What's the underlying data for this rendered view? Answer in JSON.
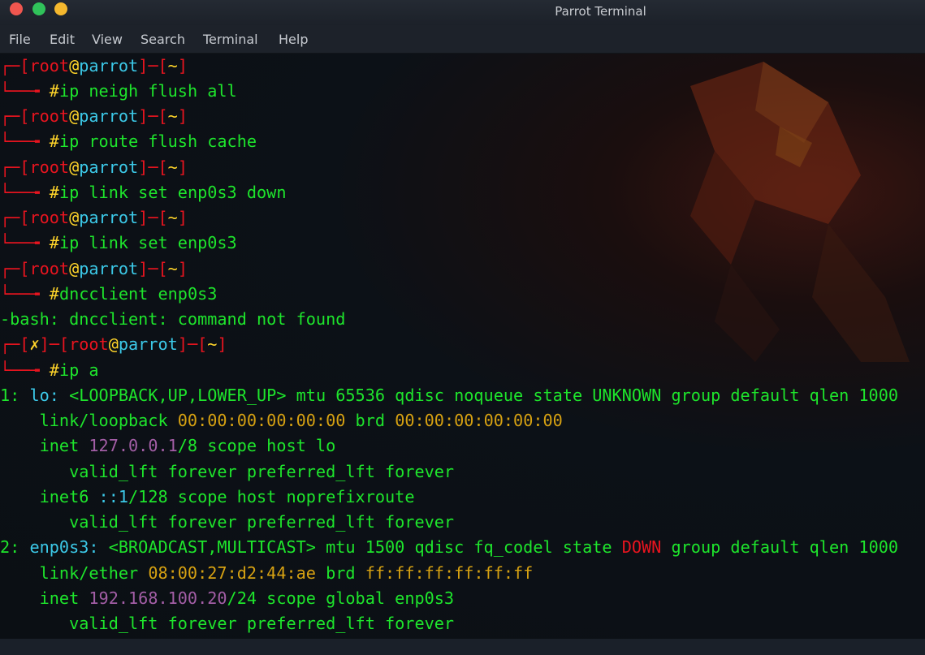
{
  "window": {
    "title": "Parrot Terminal"
  },
  "menu": [
    "File",
    "Edit",
    "View",
    "Search",
    "Terminal",
    "Help"
  ],
  "prompt": {
    "open": "┌─[",
    "user": "root",
    "at": "@",
    "host": "parrot",
    "mid": "]─[",
    "dir": "~",
    "close": "]",
    "arrow": "└──╼ ",
    "hash": "#",
    "err_open": "┌─[",
    "err_mark": "✗",
    "err_mid": "]─["
  },
  "commands": [
    "ip neigh flush all",
    "ip route flush cache",
    "ip link set enp0s3 down",
    "ip link set enp0s3",
    "dncclient enp0s3",
    "ip a"
  ],
  "error": "-bash: dncclient: command not found",
  "output": {
    "lo_head_a": "1: ",
    "lo_name": "lo:",
    "lo_head_b": " <LOOPBACK,UP,LOWER_UP> mtu 65536 qdisc noqueue state UNKNOWN group default qlen 1000",
    "lo_link_a": "    link/loopback ",
    "lo_mac": "00:00:00:00:00:00",
    "lo_link_b": " brd ",
    "lo_brd": "00:00:00:00:00:00",
    "lo_inet_a": "    inet ",
    "lo_ip": "127.0.0.1",
    "lo_inet_b": "/8 scope host lo",
    "valid1": "       valid_lft forever preferred_lft forever",
    "lo_inet6_a": "    inet6 ",
    "lo_ip6": "::1",
    "lo_inet6_b": "/128 scope host noprefixroute",
    "valid2": "       valid_lft forever preferred_lft forever",
    "en_head_a": "2: ",
    "en_name": "enp0s3:",
    "en_head_b": " <BROADCAST,MULTICAST> mtu 1500 qdisc fq_codel state ",
    "en_state": "DOWN",
    "en_head_c": " group default qlen 1000",
    "en_link_a": "    link/ether ",
    "en_mac": "08:00:27:d2:44:ae",
    "en_link_b": " brd ",
    "en_brd": "ff:ff:ff:ff:ff:ff",
    "en_inet_a": "    inet ",
    "en_ip": "192.168.100.20",
    "en_inet_b": "/24 scope global enp0s3",
    "valid3": "       valid_lft forever preferred_lft forever"
  },
  "colors": {
    "green": "#1ee52c",
    "red": "#e8141f",
    "yellow": "#ffd42a",
    "cyan": "#3cc9e8",
    "purple": "#a35ea6",
    "amber": "#d6a112"
  }
}
